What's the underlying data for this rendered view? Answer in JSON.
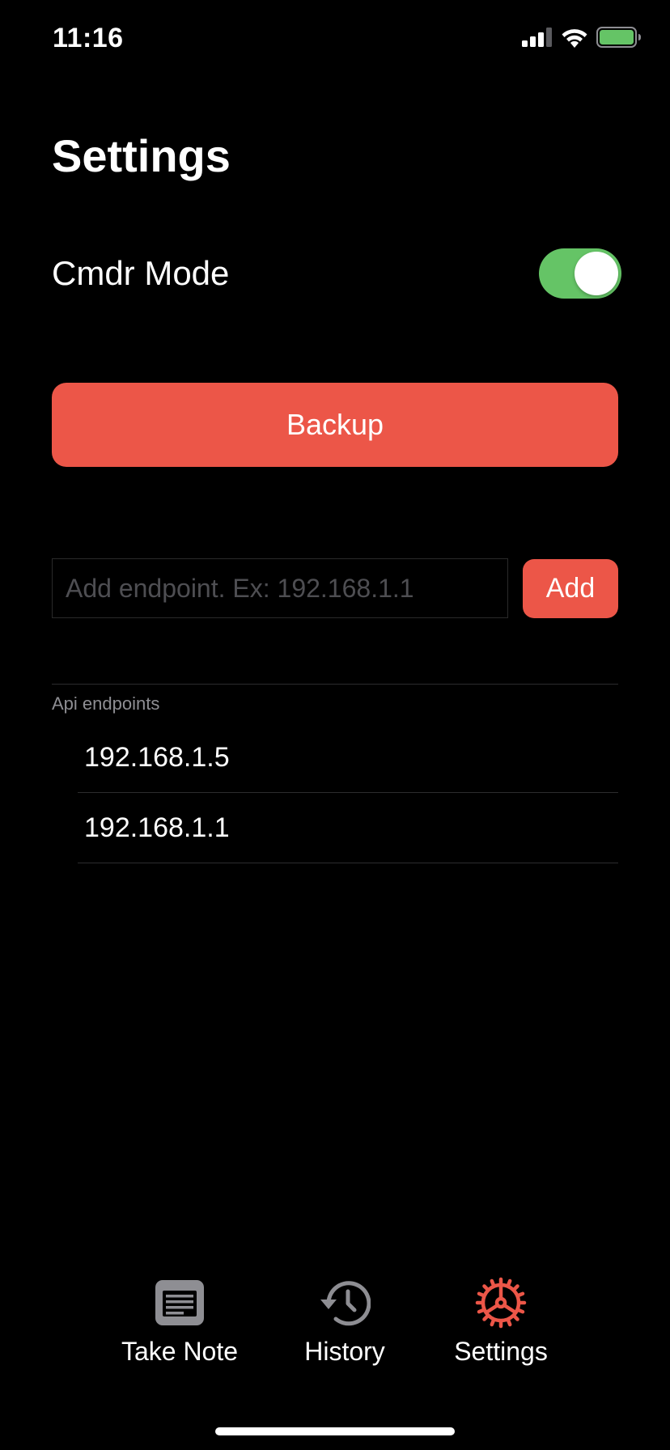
{
  "status_bar": {
    "time": "11:16"
  },
  "page": {
    "title": "Settings"
  },
  "cmdr_mode": {
    "label": "Cmdr Mode",
    "enabled": true
  },
  "backup": {
    "label": "Backup"
  },
  "endpoint_form": {
    "value": "",
    "placeholder": "Add endpoint. Ex: 192.168.1.1",
    "add_label": "Add"
  },
  "endpoints": {
    "header": "Api endpoints",
    "items": [
      "192.168.1.5",
      "192.168.1.1"
    ]
  },
  "tabs": [
    {
      "label": "Take Note",
      "icon": "note-icon",
      "active": false
    },
    {
      "label": "History",
      "icon": "history-icon",
      "active": false
    },
    {
      "label": "Settings",
      "icon": "gear-icon",
      "active": true
    }
  ],
  "colors": {
    "background": "#000000",
    "accent": "#EC5648",
    "toggle_on": "#65C466",
    "tab_inactive_icon": "#8E8E93",
    "text": "#FFFFFF"
  }
}
